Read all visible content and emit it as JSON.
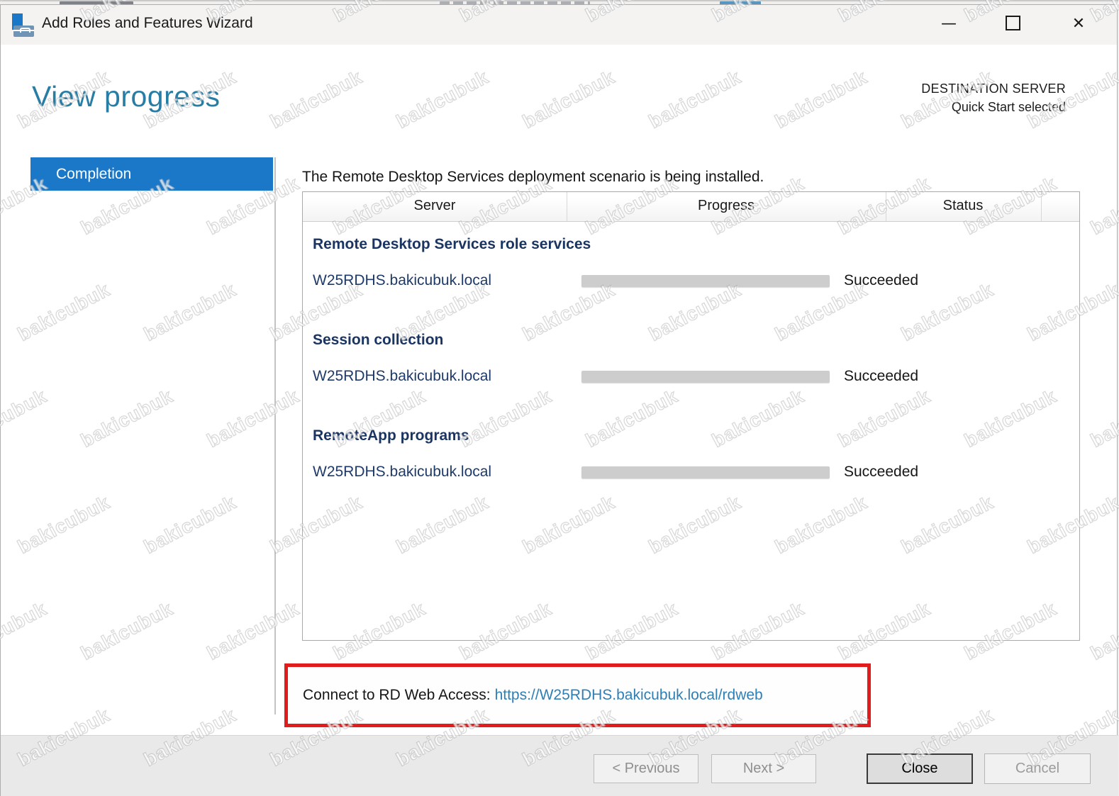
{
  "window": {
    "title": "Add Roles and Features Wizard",
    "controls": {
      "minimize": "—",
      "close": "✕"
    }
  },
  "header": {
    "page_title": "View progress",
    "destination_server_label": "DESTINATION SERVER",
    "destination_server_value": "Quick Start selected"
  },
  "sidebar": {
    "items": [
      {
        "label": "Completion",
        "selected": true
      }
    ]
  },
  "main": {
    "intro": "The Remote Desktop Services deployment scenario is being installed.",
    "table": {
      "columns": [
        "Server",
        "Progress",
        "Status"
      ],
      "sections": [
        {
          "heading": "Remote Desktop Services role services",
          "rows": [
            {
              "server": "W25RDHS.bakicubuk.local",
              "progress_percent": 98,
              "status": "Succeeded"
            }
          ]
        },
        {
          "heading": "Session collection",
          "rows": [
            {
              "server": "W25RDHS.bakicubuk.local",
              "progress_percent": 98,
              "status": "Succeeded"
            }
          ]
        },
        {
          "heading": "RemoteApp programs",
          "rows": [
            {
              "server": "W25RDHS.bakicubuk.local",
              "progress_percent": 98,
              "status": "Succeeded"
            }
          ]
        }
      ]
    },
    "connect": {
      "label": "Connect to RD Web Access:",
      "url": "https://W25RDHS.bakicubuk.local/rdweb"
    }
  },
  "footer": {
    "buttons": [
      {
        "label": "< Previous",
        "enabled": false
      },
      {
        "label": "Next >",
        "enabled": false
      },
      {
        "label": "Close",
        "enabled": true,
        "default": true
      },
      {
        "label": "Cancel",
        "enabled": false
      }
    ]
  },
  "watermark": {
    "text": "bakicubuk"
  },
  "colors": {
    "accent": "#1b78c8",
    "title-teal": "#287da5",
    "heading-navy": "#1b3562",
    "server-navy": "#1e3a68",
    "progress-teal": "#0d6e8c",
    "link-blue": "#2f7fb5",
    "highlight-red": "#e11c1c"
  }
}
